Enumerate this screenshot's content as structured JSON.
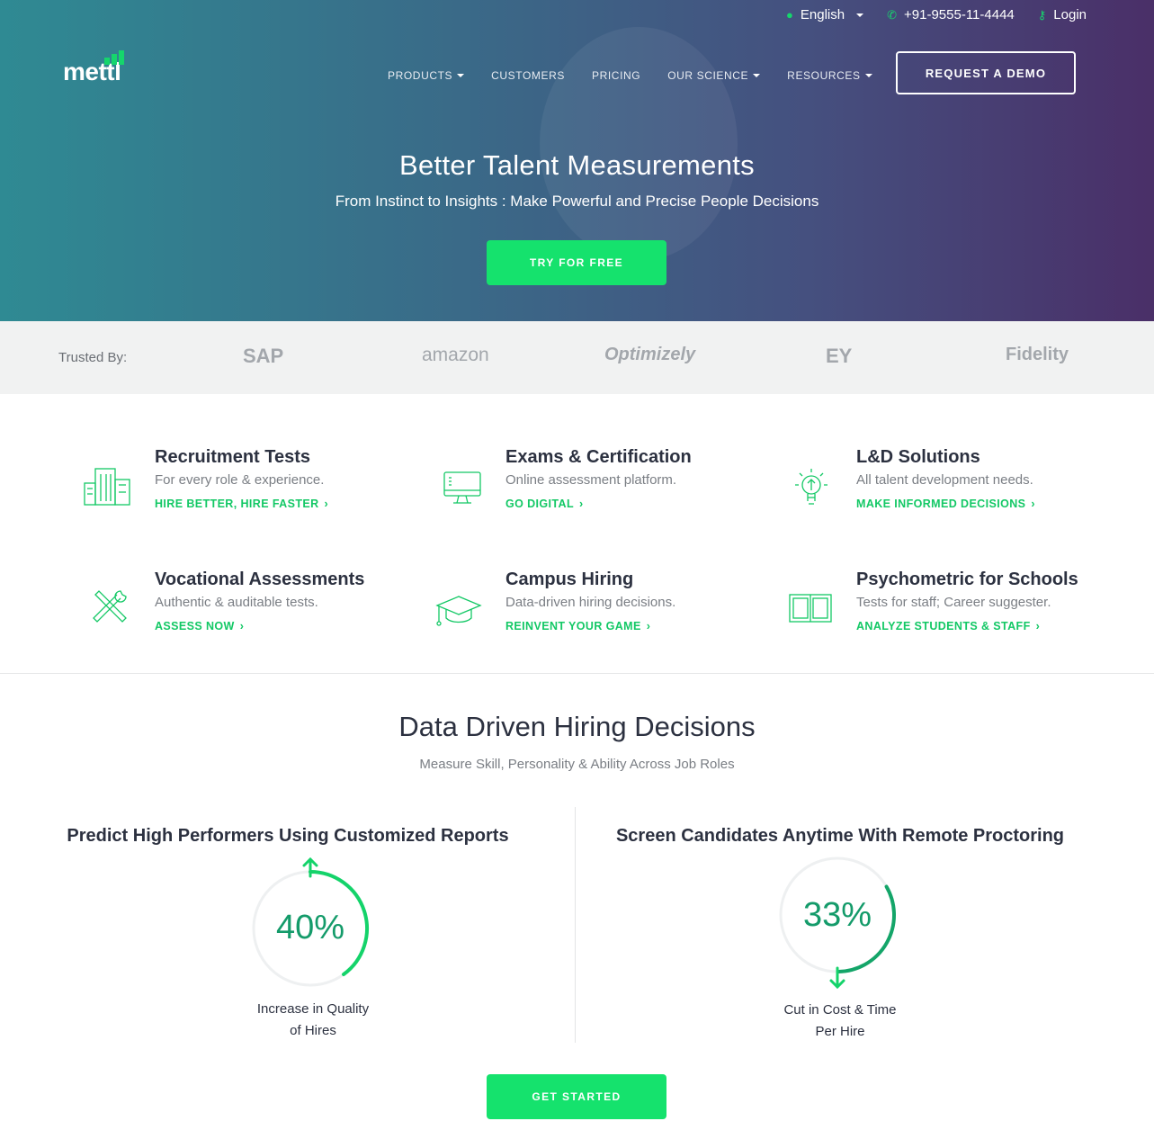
{
  "topbar": {
    "language": "English",
    "phone": "+91-9555-11-4444",
    "login": "Login"
  },
  "brand": {
    "logo_text": "mettl"
  },
  "nav": {
    "items": [
      "PRODUCTS",
      "CUSTOMERS",
      "PRICING",
      "OUR SCIENCE",
      "RESOURCES"
    ],
    "demo_button": "REQUEST A DEMO"
  },
  "hero": {
    "title": "Better Talent Measurements",
    "subtitle": "From Instinct to Insights : Make Powerful and Precise People Decisions",
    "cta": "TRY FOR FREE"
  },
  "trusted": {
    "label": "Trusted By:",
    "brands": [
      "SAP",
      "amazon",
      "Optimizely",
      "EY",
      "Fidelity"
    ]
  },
  "features": [
    {
      "title": "Recruitment Tests",
      "desc": "For every role & experience.",
      "link": "HIRE BETTER, HIRE FASTER",
      "icon": "buildings-icon"
    },
    {
      "title": "Exams & Certification",
      "desc": "Online assessment platform.",
      "link": "GO DIGITAL",
      "icon": "monitor-icon"
    },
    {
      "title": "L&D Solutions",
      "desc": "All talent development needs.",
      "link": "MAKE INFORMED DECISIONS",
      "icon": "lightbulb-icon"
    },
    {
      "title": "Vocational Assessments",
      "desc": "Authentic & auditable tests.",
      "link": "ASSESS NOW",
      "icon": "tools-icon"
    },
    {
      "title": "Campus Hiring",
      "desc": "Data-driven hiring decisions.",
      "link": "REINVENT YOUR GAME",
      "icon": "graduation-cap-icon"
    },
    {
      "title": "Psychometric for Schools",
      "desc": "Tests for staff; Career suggester.",
      "link": "ANALYZE STUDENTS & STAFF",
      "icon": "open-book-icon"
    }
  ],
  "section": {
    "title": "Data Driven Hiring Decisions",
    "subtitle": "Measure Skill, Personality & Ability Across Job Roles"
  },
  "stats": [
    {
      "title": "Predict High Performers Using Customized Reports",
      "value": "40%",
      "fraction": 0.4,
      "caption_line1": "Increase in Quality",
      "caption_line2": "of Hires",
      "direction": "up"
    },
    {
      "title": "Screen Candidates Anytime With Remote Proctoring",
      "value": "33%",
      "fraction": 0.33,
      "caption_line1": "Cut in Cost & Time",
      "caption_line2": "Per Hire",
      "direction": "down"
    }
  ],
  "get_started": "GET STARTED",
  "colors": {
    "accent": "#15e26d",
    "link_green": "#13c865",
    "stat_teal": "#149b6a"
  }
}
